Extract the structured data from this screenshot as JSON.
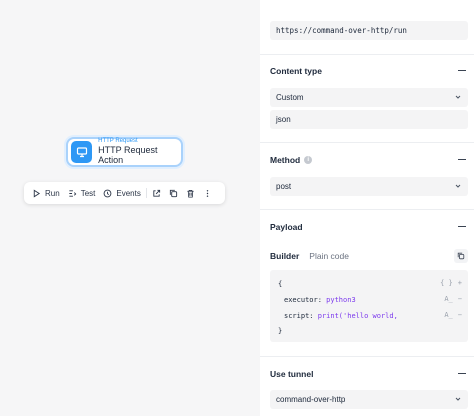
{
  "node": {
    "type_label": "HTTP Request",
    "name": "HTTP Request Action"
  },
  "toolbar": {
    "run_label": "Run",
    "test_label": "Test",
    "events_label": "Events"
  },
  "panel": {
    "url_value": "https://command-over-http/run",
    "content_type": {
      "title": "Content type",
      "selected": "Custom",
      "custom_value": "json"
    },
    "method": {
      "title": "Method",
      "selected": "post"
    },
    "payload": {
      "title": "Payload",
      "tabs": [
        "Builder",
        "Plain code"
      ],
      "code": {
        "open_brace": "{",
        "executor_key": "executor:",
        "executor_value": "python3",
        "script_key": "script:",
        "script_value": "print('hello world, ",
        "close_brace": "}"
      }
    },
    "tunnel": {
      "title": "Use tunnel",
      "selected": "command-over-http"
    }
  },
  "colors": {
    "accent": "#2e98f5",
    "node_border": "#a9d2fb",
    "code_value": "#7c3aed"
  }
}
